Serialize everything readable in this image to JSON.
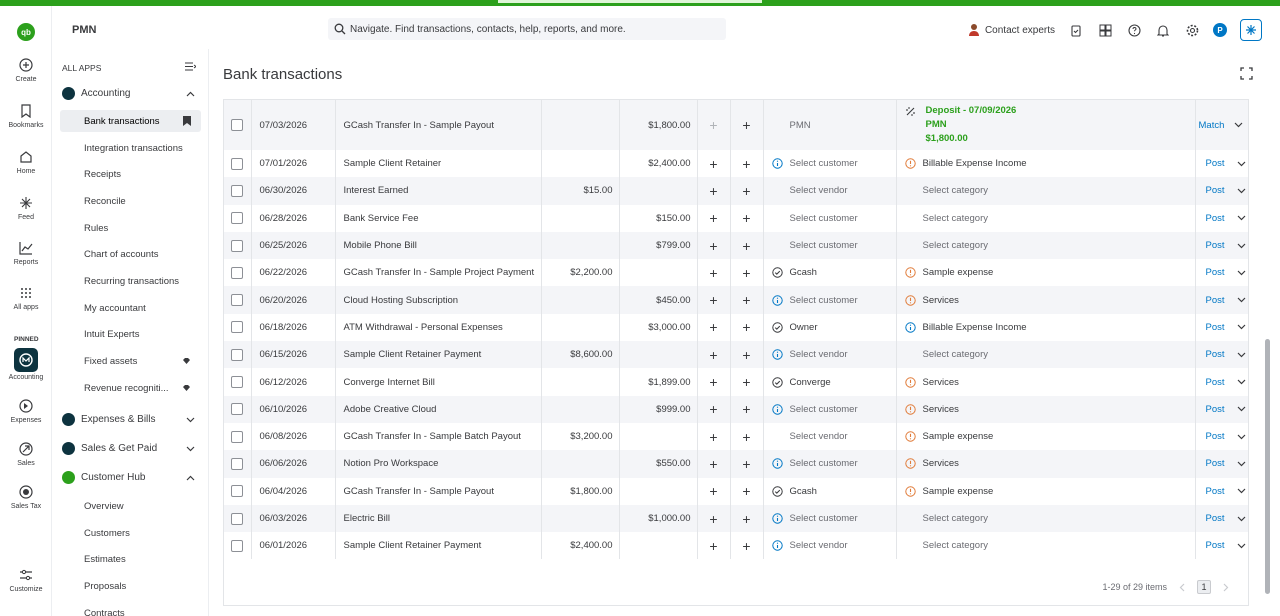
{
  "header": {
    "company": "PMN",
    "search_placeholder": "Navigate. Find transactions, contacts, help, reports, and more.",
    "contact_experts": "Contact experts",
    "avatar_initial": "P"
  },
  "rail": {
    "logo": "qb",
    "create": "Create",
    "bookmarks": "Bookmarks",
    "home": "Home",
    "feed": "Feed",
    "reports": "Reports",
    "all_apps": "All apps",
    "pinned": "PINNED",
    "accounting": "Accounting",
    "expenses": "Expenses",
    "sales": "Sales",
    "sales_tax": "Sales Tax",
    "customize": "Customize"
  },
  "sidebar": {
    "all_apps": "ALL APPS",
    "accounting": "Accounting",
    "items": [
      {
        "label": "Bank transactions"
      },
      {
        "label": "Integration transactions"
      },
      {
        "label": "Receipts"
      },
      {
        "label": "Reconcile"
      },
      {
        "label": "Rules"
      },
      {
        "label": "Chart of accounts"
      },
      {
        "label": "Recurring transactions"
      },
      {
        "label": "My accountant"
      },
      {
        "label": "Intuit Experts"
      },
      {
        "label": "Fixed assets"
      },
      {
        "label": "Revenue recogniti..."
      }
    ],
    "expenses_bills": "Expenses & Bills",
    "sales_get_paid": "Sales & Get Paid",
    "customer_hub": "Customer Hub",
    "hub_items": [
      {
        "label": "Overview"
      },
      {
        "label": "Customers"
      },
      {
        "label": "Estimates"
      },
      {
        "label": "Proposals"
      },
      {
        "label": "Contracts"
      }
    ]
  },
  "main": {
    "title": "Bank transactions",
    "match_row": {
      "date": "07/03/2026",
      "description": "GCash Transfer In - Sample Payout",
      "spent": "",
      "received": "$1,800.00",
      "payee": "PMN",
      "match_line1": "Deposit - 07/09/2026",
      "match_line2": "PMN",
      "match_line3": "$1,800.00",
      "action": "Match"
    },
    "rows": [
      {
        "date": "07/01/2026",
        "description": "Sample Client Retainer",
        "spent": "",
        "received": "$2,400.00",
        "payee": "Select customer",
        "payee_icon": "info",
        "category": "Billable Expense Income",
        "cat_icon": "warning",
        "action": "Post"
      },
      {
        "date": "06/30/2026",
        "description": "Interest Earned",
        "spent": "$15.00",
        "received": "",
        "payee": "Select vendor",
        "payee_icon": "",
        "category": "Select category",
        "cat_icon": "",
        "action": "Post"
      },
      {
        "date": "06/28/2026",
        "description": "Bank Service Fee",
        "spent": "",
        "received": "$150.00",
        "payee": "Select customer",
        "payee_icon": "",
        "category": "Select category",
        "cat_icon": "",
        "action": "Post"
      },
      {
        "date": "06/25/2026",
        "description": "Mobile Phone Bill",
        "spent": "",
        "received": "$799.00",
        "payee": "Select customer",
        "payee_icon": "",
        "category": "Select category",
        "cat_icon": "",
        "action": "Post"
      },
      {
        "date": "06/22/2026",
        "description": "GCash Transfer In - Sample Project Payment",
        "spent": "$2,200.00",
        "received": "",
        "payee": "Gcash",
        "payee_icon": "check",
        "category": "Sample expense",
        "cat_icon": "warning",
        "action": "Post"
      },
      {
        "date": "06/20/2026",
        "description": "Cloud Hosting Subscription",
        "spent": "",
        "received": "$450.00",
        "payee": "Select customer",
        "payee_icon": "info",
        "category": "Services",
        "cat_icon": "warning",
        "action": "Post"
      },
      {
        "date": "06/18/2026",
        "description": "ATM Withdrawal - Personal Expenses",
        "spent": "",
        "received": "$3,000.00",
        "payee": "Owner",
        "payee_icon": "check",
        "category": "Billable Expense Income",
        "cat_icon": "info",
        "action": "Post"
      },
      {
        "date": "06/15/2026",
        "description": "Sample Client Retainer Payment",
        "spent": "$8,600.00",
        "received": "",
        "payee": "Select vendor",
        "payee_icon": "info",
        "category": "Select category",
        "cat_icon": "",
        "action": "Post"
      },
      {
        "date": "06/12/2026",
        "description": "Converge Internet Bill",
        "spent": "",
        "received": "$1,899.00",
        "payee": "Converge",
        "payee_icon": "check",
        "category": "Services",
        "cat_icon": "warning",
        "action": "Post"
      },
      {
        "date": "06/10/2026",
        "description": "Adobe Creative Cloud",
        "spent": "",
        "received": "$999.00",
        "payee": "Select customer",
        "payee_icon": "info",
        "category": "Services",
        "cat_icon": "warning",
        "action": "Post"
      },
      {
        "date": "06/08/2026",
        "description": "GCash Transfer In - Sample Batch Payout",
        "spent": "$3,200.00",
        "received": "",
        "payee": "Select vendor",
        "payee_icon": "",
        "category": "Sample expense",
        "cat_icon": "warning",
        "action": "Post"
      },
      {
        "date": "06/06/2026",
        "description": "Notion Pro Workspace",
        "spent": "",
        "received": "$550.00",
        "payee": "Select customer",
        "payee_icon": "info",
        "category": "Services",
        "cat_icon": "warning",
        "action": "Post"
      },
      {
        "date": "06/04/2026",
        "description": "GCash Transfer In - Sample Payout",
        "spent": "$1,800.00",
        "received": "",
        "payee": "Gcash",
        "payee_icon": "check",
        "category": "Sample expense",
        "cat_icon": "warning",
        "action": "Post"
      },
      {
        "date": "06/03/2026",
        "description": "Electric Bill",
        "spent": "",
        "received": "$1,000.00",
        "payee": "Select customer",
        "payee_icon": "info",
        "category": "Select category",
        "cat_icon": "",
        "action": "Post"
      },
      {
        "date": "06/01/2026",
        "description": "Sample Client Retainer Payment",
        "spent": "$2,400.00",
        "received": "",
        "payee": "Select vendor",
        "payee_icon": "info",
        "category": "Select category",
        "cat_icon": "",
        "action": "Post"
      }
    ],
    "pagination": {
      "range": "1-29 of 29 items",
      "page": "1"
    }
  },
  "colors": {
    "brand": "#2ca01c",
    "link": "#0077c5",
    "warning": "#e07b39",
    "dark": "#0d333f"
  }
}
